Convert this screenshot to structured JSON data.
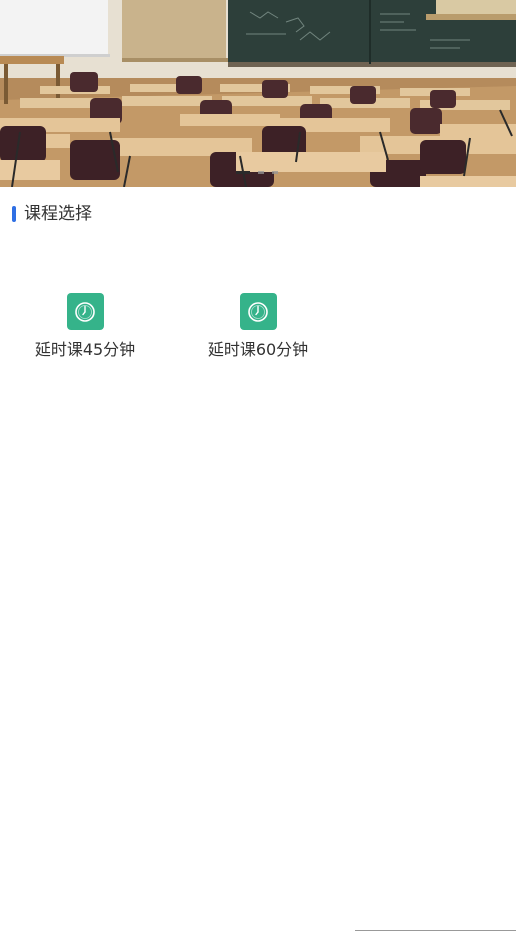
{
  "banner": {
    "dot_count": 3,
    "active_dot": 0
  },
  "section": {
    "title": "课程选择",
    "accent_color": "#2f6fe4"
  },
  "courses": [
    {
      "label": "延时课45分钟",
      "icon": "clock-icon"
    },
    {
      "label": "延时课60分钟",
      "icon": "clock-icon"
    }
  ],
  "colors": {
    "icon_bg": "#35b38a",
    "text": "#333333"
  }
}
